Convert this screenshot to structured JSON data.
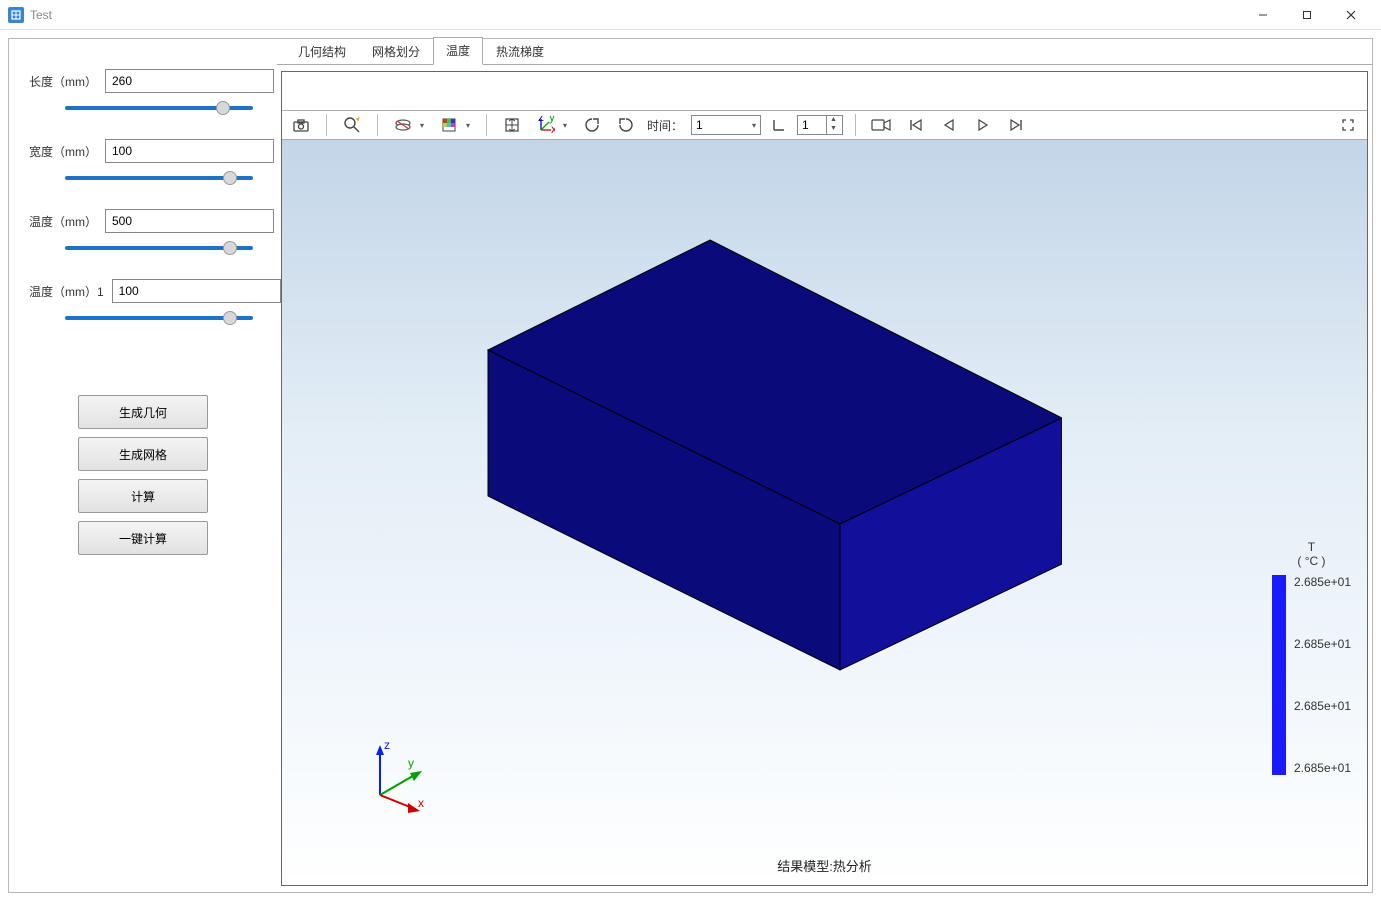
{
  "window": {
    "title": "Test"
  },
  "sidebar": {
    "params": [
      {
        "label": "长度（mm）",
        "value": "260"
      },
      {
        "label": "宽度（mm）",
        "value": "100"
      },
      {
        "label": "温度（mm）",
        "value": "500"
      },
      {
        "label": "温度（mm）1",
        "value": "100"
      }
    ],
    "buttons": [
      "生成几何",
      "生成网格",
      "计算",
      "一键计算"
    ]
  },
  "tabs": {
    "items": [
      "几何结构",
      "网格划分",
      "温度",
      "热流梯度"
    ],
    "activeIndex": 2
  },
  "toolbar": {
    "timeLabel": "时间：",
    "timeValue": "1",
    "spinnerValue": "1"
  },
  "legend": {
    "title1": "T",
    "title2": "( °C )",
    "ticks": [
      "2.685e+01",
      "2.685e+01",
      "2.685e+01",
      "2.685e+01"
    ]
  },
  "scene": {
    "footer": "结果模型:热分析",
    "axes": {
      "x": "x",
      "y": "y",
      "z": "z"
    }
  }
}
